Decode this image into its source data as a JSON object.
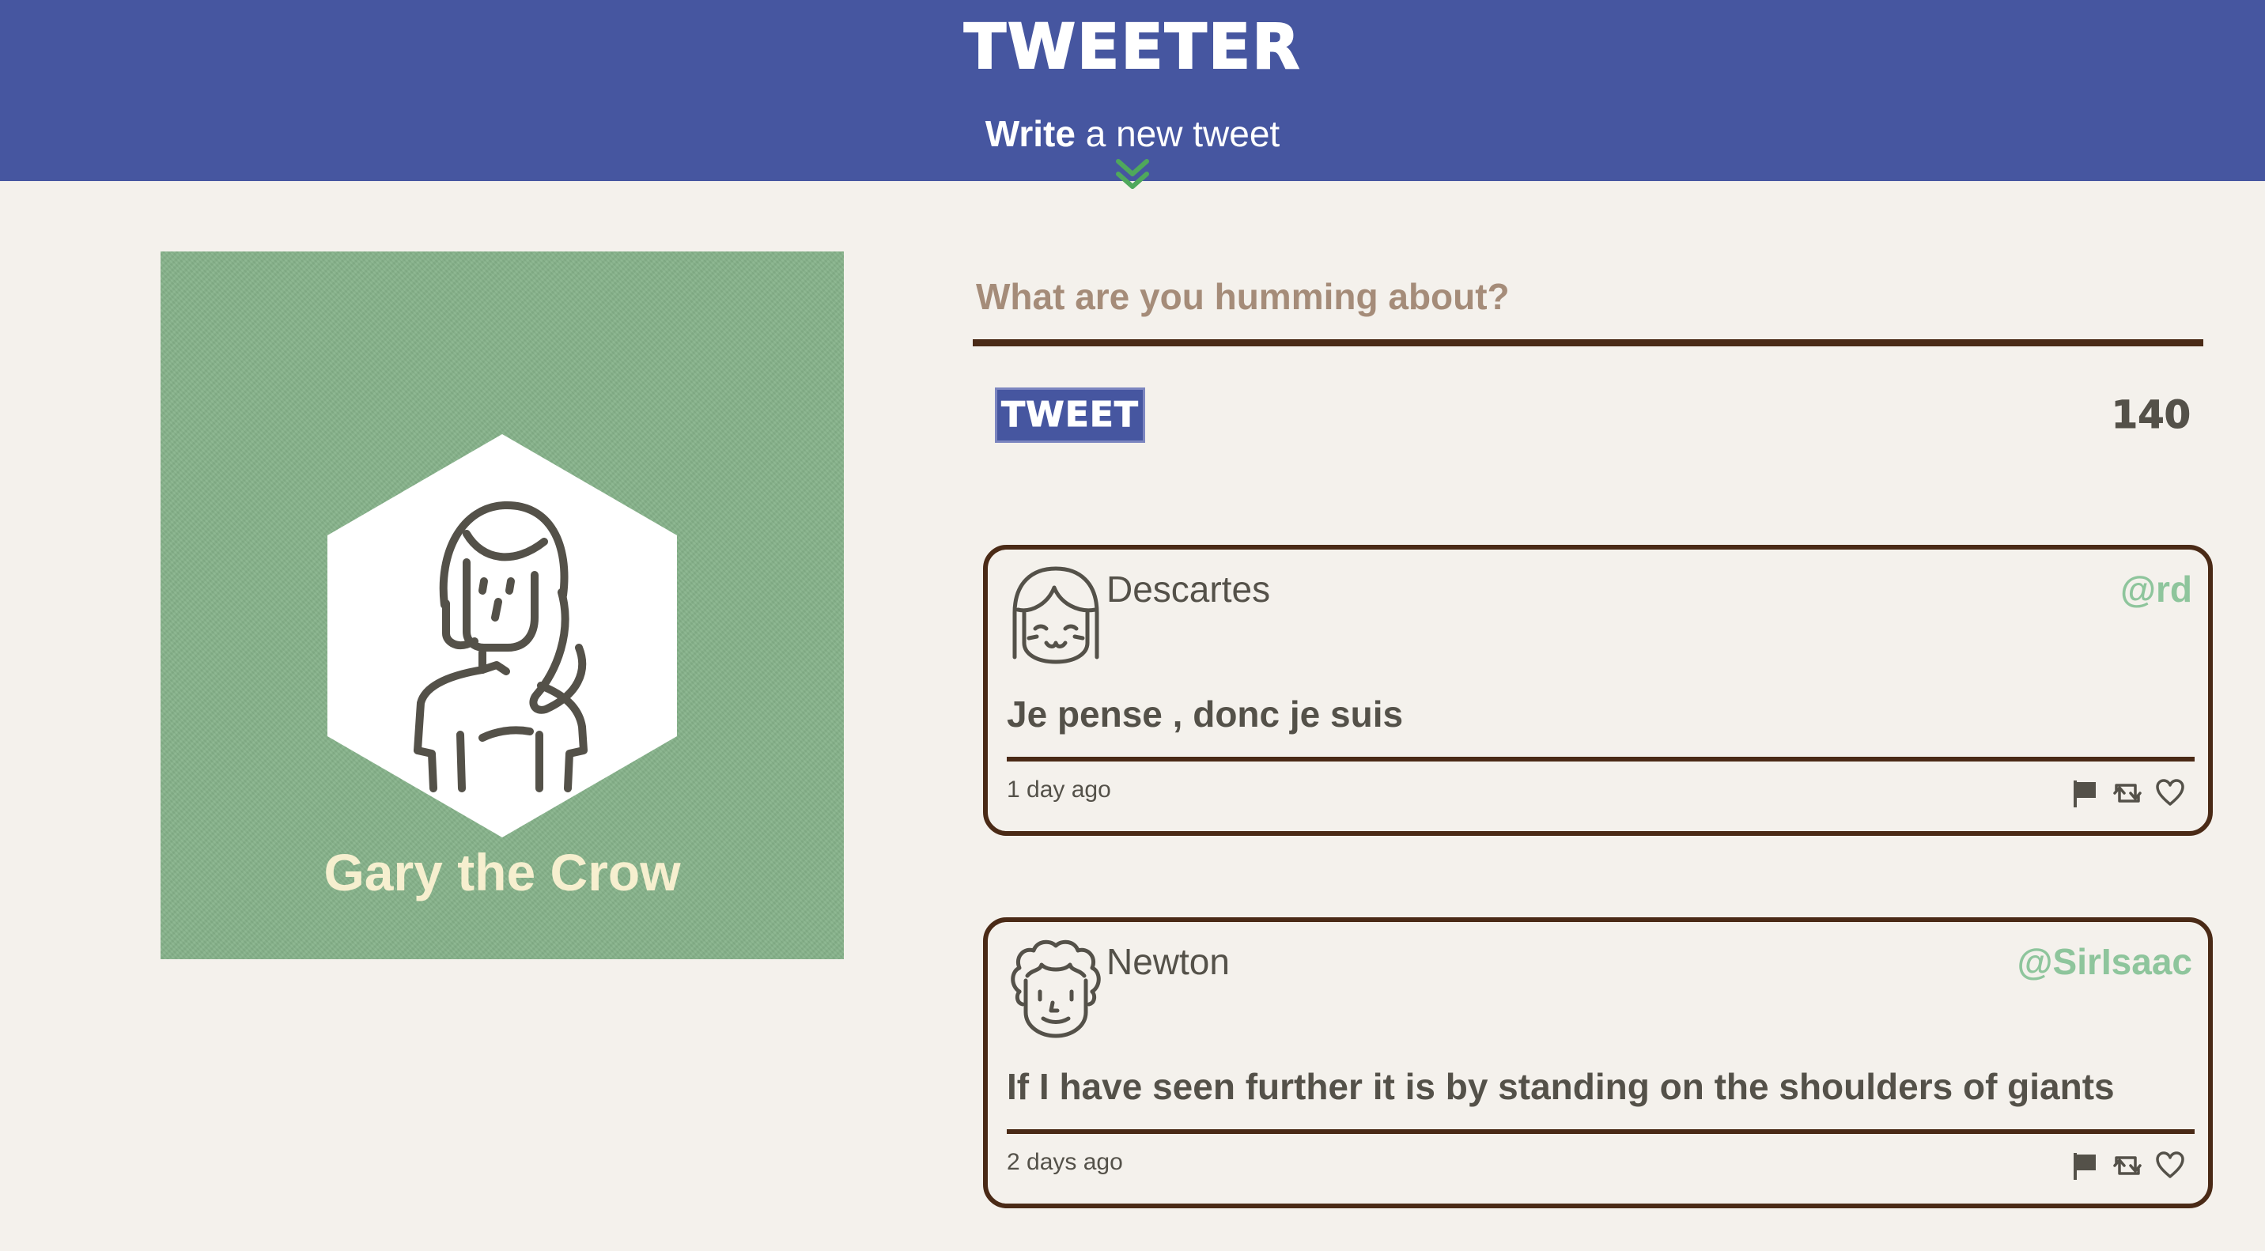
{
  "nav": {
    "brand": "TWEETER",
    "compose_toggle": {
      "strong": "Write",
      "rest": " a new tweet"
    },
    "chevron_icon": "double-chevron-down-icon",
    "background_color": "#4656a0",
    "chevron_color": "#4fa85c"
  },
  "profile": {
    "name": "Gary the Crow",
    "avatar_icon": "user-avatar-icon",
    "background_color": "#86b38a",
    "name_color": "#f6efcf"
  },
  "compose": {
    "placeholder": "What are you humming about?",
    "value": "",
    "submit_label": "TWEET",
    "counter": "140"
  },
  "tweets": [
    {
      "author": "Descartes",
      "handle": "@rd",
      "content": "Je pense , donc je suis",
      "time": "1 day ago",
      "avatar_icon": "descartes-avatar-icon",
      "actions": [
        "flag-icon",
        "retweet-icon",
        "heart-icon"
      ]
    },
    {
      "author": "Newton",
      "handle": "@SirIsaac",
      "content": "If I have seen further it is by standing on the shoulders of giants",
      "time": "2 days ago",
      "avatar_icon": "newton-avatar-icon",
      "actions": [
        "flag-icon",
        "retweet-icon",
        "heart-icon"
      ]
    }
  ],
  "colors": {
    "page_background": "#f4f1ec",
    "text": "#545149",
    "border": "#4a2a16",
    "handle": "#8ec59c",
    "placeholder": "#a58c79"
  }
}
